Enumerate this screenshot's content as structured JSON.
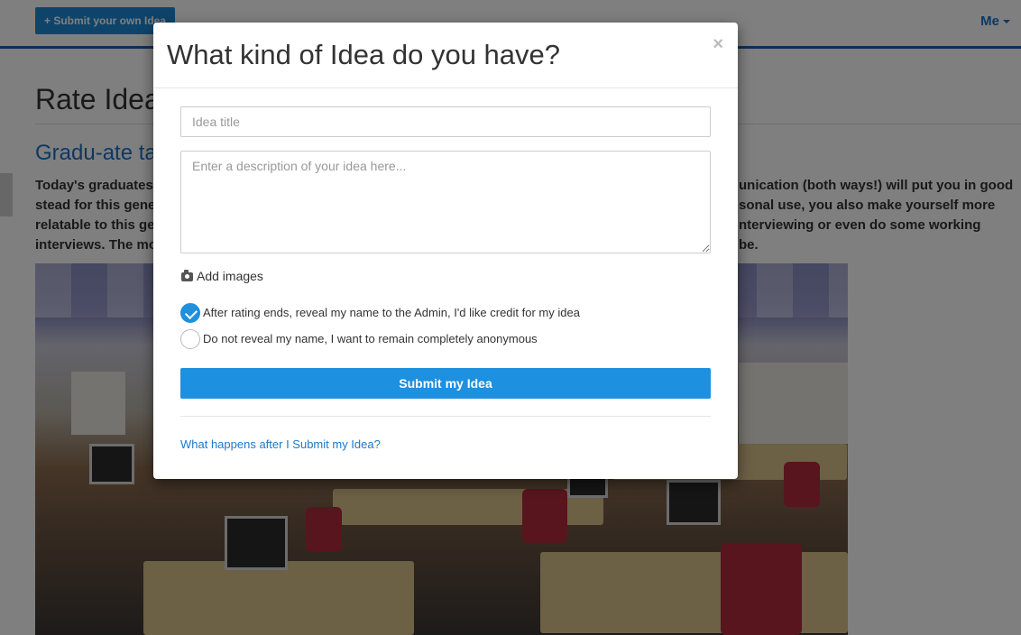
{
  "topbar": {
    "submit_own_label": "+ Submit your own Idea",
    "me_label": "Me"
  },
  "page": {
    "title": "Rate Ideas",
    "idea_title": "Gradu-ate ta",
    "description_lines_left": [
      "Today's graduates a",
      "stead for this gener",
      "relatable to this gen",
      "interviews. The mo"
    ],
    "description_lines_right": [
      "unication (both ways!) will put you in good",
      "sonal use, you also make yourself more",
      "nterviewing or even do some working",
      "be."
    ]
  },
  "modal": {
    "title": "What kind of Idea do you have?",
    "close_label": "×",
    "title_placeholder": "Idea title",
    "description_placeholder": "Enter a description of your idea here...",
    "add_images_label": "Add images",
    "options": [
      {
        "label": "After rating ends, reveal my name to the Admin, I'd like credit for my idea",
        "selected": true
      },
      {
        "label": "Do not reveal my name, I want to remain completely anonymous",
        "selected": false
      }
    ],
    "submit_label": "Submit my Idea",
    "help_link": "What happens after I Submit my Idea?"
  },
  "colors": {
    "accent": "#1e90e0",
    "link": "#1e78c8",
    "topbar_border": "#1f5fa8"
  }
}
